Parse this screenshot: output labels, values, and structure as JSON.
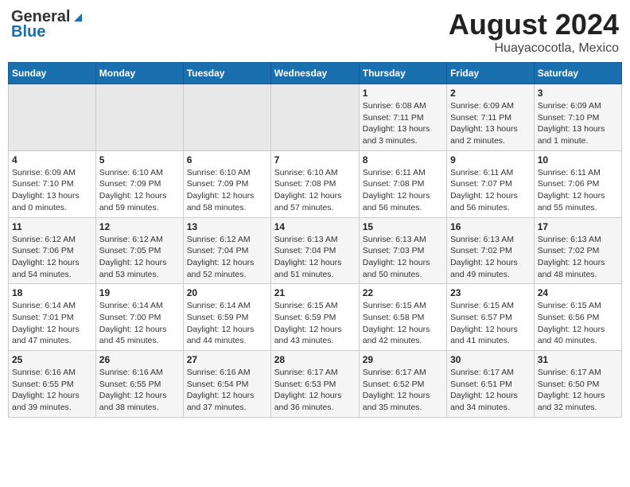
{
  "header": {
    "logo_general": "General",
    "logo_blue": "Blue",
    "title": "August 2024",
    "subtitle": "Huayacocotla, Mexico"
  },
  "weekdays": [
    "Sunday",
    "Monday",
    "Tuesday",
    "Wednesday",
    "Thursday",
    "Friday",
    "Saturday"
  ],
  "weeks": [
    [
      {
        "day": "",
        "sunrise": "",
        "sunset": "",
        "daylight": "",
        "empty": true
      },
      {
        "day": "",
        "sunrise": "",
        "sunset": "",
        "daylight": "",
        "empty": true
      },
      {
        "day": "",
        "sunrise": "",
        "sunset": "",
        "daylight": "",
        "empty": true
      },
      {
        "day": "",
        "sunrise": "",
        "sunset": "",
        "daylight": "",
        "empty": true
      },
      {
        "day": "1",
        "sunrise": "6:08 AM",
        "sunset": "7:11 PM",
        "daylight": "13 hours and 3 minutes."
      },
      {
        "day": "2",
        "sunrise": "6:09 AM",
        "sunset": "7:11 PM",
        "daylight": "13 hours and 2 minutes."
      },
      {
        "day": "3",
        "sunrise": "6:09 AM",
        "sunset": "7:10 PM",
        "daylight": "13 hours and 1 minute."
      }
    ],
    [
      {
        "day": "4",
        "sunrise": "6:09 AM",
        "sunset": "7:10 PM",
        "daylight": "13 hours and 0 minutes."
      },
      {
        "day": "5",
        "sunrise": "6:10 AM",
        "sunset": "7:09 PM",
        "daylight": "12 hours and 59 minutes."
      },
      {
        "day": "6",
        "sunrise": "6:10 AM",
        "sunset": "7:09 PM",
        "daylight": "12 hours and 58 minutes."
      },
      {
        "day": "7",
        "sunrise": "6:10 AM",
        "sunset": "7:08 PM",
        "daylight": "12 hours and 57 minutes."
      },
      {
        "day": "8",
        "sunrise": "6:11 AM",
        "sunset": "7:08 PM",
        "daylight": "12 hours and 56 minutes."
      },
      {
        "day": "9",
        "sunrise": "6:11 AM",
        "sunset": "7:07 PM",
        "daylight": "12 hours and 56 minutes."
      },
      {
        "day": "10",
        "sunrise": "6:11 AM",
        "sunset": "7:06 PM",
        "daylight": "12 hours and 55 minutes."
      }
    ],
    [
      {
        "day": "11",
        "sunrise": "6:12 AM",
        "sunset": "7:06 PM",
        "daylight": "12 hours and 54 minutes."
      },
      {
        "day": "12",
        "sunrise": "6:12 AM",
        "sunset": "7:05 PM",
        "daylight": "12 hours and 53 minutes."
      },
      {
        "day": "13",
        "sunrise": "6:12 AM",
        "sunset": "7:04 PM",
        "daylight": "12 hours and 52 minutes."
      },
      {
        "day": "14",
        "sunrise": "6:13 AM",
        "sunset": "7:04 PM",
        "daylight": "12 hours and 51 minutes."
      },
      {
        "day": "15",
        "sunrise": "6:13 AM",
        "sunset": "7:03 PM",
        "daylight": "12 hours and 50 minutes."
      },
      {
        "day": "16",
        "sunrise": "6:13 AM",
        "sunset": "7:02 PM",
        "daylight": "12 hours and 49 minutes."
      },
      {
        "day": "17",
        "sunrise": "6:13 AM",
        "sunset": "7:02 PM",
        "daylight": "12 hours and 48 minutes."
      }
    ],
    [
      {
        "day": "18",
        "sunrise": "6:14 AM",
        "sunset": "7:01 PM",
        "daylight": "12 hours and 47 minutes."
      },
      {
        "day": "19",
        "sunrise": "6:14 AM",
        "sunset": "7:00 PM",
        "daylight": "12 hours and 45 minutes."
      },
      {
        "day": "20",
        "sunrise": "6:14 AM",
        "sunset": "6:59 PM",
        "daylight": "12 hours and 44 minutes."
      },
      {
        "day": "21",
        "sunrise": "6:15 AM",
        "sunset": "6:59 PM",
        "daylight": "12 hours and 43 minutes."
      },
      {
        "day": "22",
        "sunrise": "6:15 AM",
        "sunset": "6:58 PM",
        "daylight": "12 hours and 42 minutes."
      },
      {
        "day": "23",
        "sunrise": "6:15 AM",
        "sunset": "6:57 PM",
        "daylight": "12 hours and 41 minutes."
      },
      {
        "day": "24",
        "sunrise": "6:15 AM",
        "sunset": "6:56 PM",
        "daylight": "12 hours and 40 minutes."
      }
    ],
    [
      {
        "day": "25",
        "sunrise": "6:16 AM",
        "sunset": "6:55 PM",
        "daylight": "12 hours and 39 minutes."
      },
      {
        "day": "26",
        "sunrise": "6:16 AM",
        "sunset": "6:55 PM",
        "daylight": "12 hours and 38 minutes."
      },
      {
        "day": "27",
        "sunrise": "6:16 AM",
        "sunset": "6:54 PM",
        "daylight": "12 hours and 37 minutes."
      },
      {
        "day": "28",
        "sunrise": "6:17 AM",
        "sunset": "6:53 PM",
        "daylight": "12 hours and 36 minutes."
      },
      {
        "day": "29",
        "sunrise": "6:17 AM",
        "sunset": "6:52 PM",
        "daylight": "12 hours and 35 minutes."
      },
      {
        "day": "30",
        "sunrise": "6:17 AM",
        "sunset": "6:51 PM",
        "daylight": "12 hours and 34 minutes."
      },
      {
        "day": "31",
        "sunrise": "6:17 AM",
        "sunset": "6:50 PM",
        "daylight": "12 hours and 32 minutes."
      }
    ]
  ],
  "labels": {
    "sunrise": "Sunrise:",
    "sunset": "Sunset:",
    "daylight": "Daylight hours"
  }
}
